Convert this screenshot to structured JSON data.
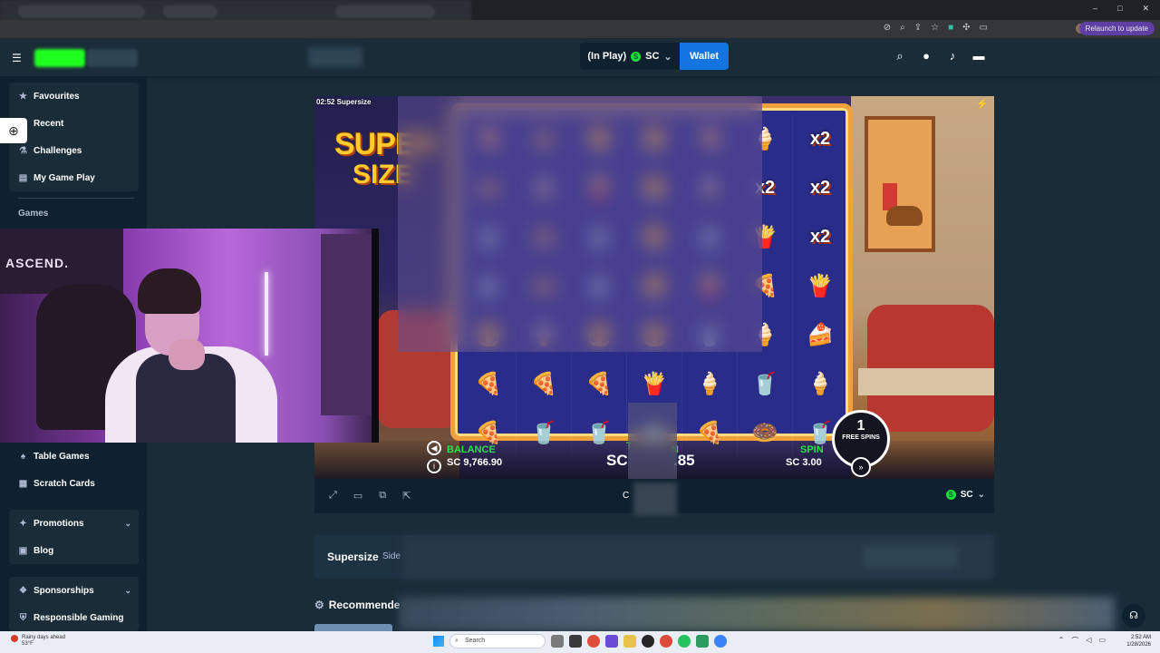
{
  "browser": {
    "relaunch_label": "Relaunch to update",
    "window_controls": [
      "–",
      "□",
      "✕"
    ],
    "addr_icons": [
      "eye-off-icon",
      "zoom-icon",
      "share-icon",
      "star-icon",
      "extension-icon",
      "puzzle-icon",
      "sidebar-icon"
    ]
  },
  "header": {
    "menu_icon": "hamburger-icon",
    "balance_status": "(In Play)",
    "currency_symbol": "S",
    "currency": "SC",
    "currency_chevron": "⌄",
    "wallet_label": "Wallet",
    "icons": [
      "search-icon",
      "user-icon",
      "bell-icon",
      "chat-icon"
    ]
  },
  "sidebar": {
    "group1": [
      {
        "label": "Favourites",
        "icon": "star-icon",
        "glyph": "★"
      },
      {
        "label": "Recent",
        "icon": "clock-icon",
        "glyph": "◷"
      },
      {
        "label": "Challenges",
        "icon": "flask-icon",
        "glyph": "⚗"
      },
      {
        "label": "My Game Play",
        "icon": "chart-icon",
        "glyph": "▤"
      }
    ],
    "games_heading": "Games",
    "group2": [
      {
        "label": "Table Games",
        "icon": "cards-icon",
        "glyph": "♠"
      },
      {
        "label": "Scratch Cards",
        "icon": "grid-icon",
        "glyph": "▦"
      }
    ],
    "group3": [
      {
        "label": "Promotions",
        "icon": "gift-icon",
        "glyph": "✦",
        "chevron": "⌄"
      },
      {
        "label": "Blog",
        "icon": "book-icon",
        "glyph": "▣"
      }
    ],
    "group4": [
      {
        "label": "Sponsorships",
        "icon": "handshake-icon",
        "glyph": "❖",
        "chevron": "⌄"
      },
      {
        "label": "Responsible Gaming",
        "icon": "shield-icon",
        "glyph": "⛨"
      }
    ]
  },
  "webcam": {
    "banner_text": "ASCEND."
  },
  "game": {
    "timer_label": "02:52 Supersize",
    "logo_line1": "SUPER",
    "logo_line2": "SIZE",
    "reels": [
      [
        "🍕",
        "🍩",
        "🍔",
        "🍔",
        "🍕",
        "🍦",
        "x2"
      ],
      [
        "🍩",
        "🍦",
        "🍟",
        "🍔",
        "🍦",
        "x2",
        "x2"
      ],
      [
        "🥤",
        "🍩",
        "🥤",
        "🍔",
        "🥤",
        "🍟",
        "x2"
      ],
      [
        "🥤",
        "🍩",
        "🥤",
        "🍔",
        "🍟",
        "🍕",
        "🍟"
      ],
      [
        "🍔",
        "🍦",
        "🍔",
        "🍔",
        "🥤",
        "🍦",
        "🍰"
      ],
      [
        "🍕",
        "🍕",
        "🍕",
        "🍟",
        "🍦",
        "🥤",
        "🍦"
      ],
      [
        "🍕",
        "🥤",
        "🥤",
        "🥤",
        "🍕",
        "🍩",
        "🥤"
      ]
    ],
    "balance_label": "BALANCE",
    "balance_value": "SC 9,766.90",
    "win_label_partial": "T",
    "win_label_end": "N",
    "win_value_start": "SC",
    "win_value_end": ".85",
    "spin_label": "SPIN",
    "spin_value": "SC 3.00",
    "free_spins_count": "1",
    "free_spins_label": "FREE SPINS"
  },
  "game_footer": {
    "icons": [
      "fullscreen-icon",
      "theatre-icon",
      "stats-icon",
      "popout-icon"
    ],
    "center_text": "C",
    "currency_symbol": "S",
    "currency": "SC",
    "chevron": "⌄"
  },
  "info": {
    "title": "Supersize",
    "subtitle": "Side"
  },
  "recommended": {
    "title": "Recommende"
  },
  "taskbar": {
    "weather_line1": "Rainy days ahead",
    "weather_line2": "53°F",
    "search_placeholder": "Search",
    "time": "2:52 AM",
    "date": "1/28/2026"
  }
}
